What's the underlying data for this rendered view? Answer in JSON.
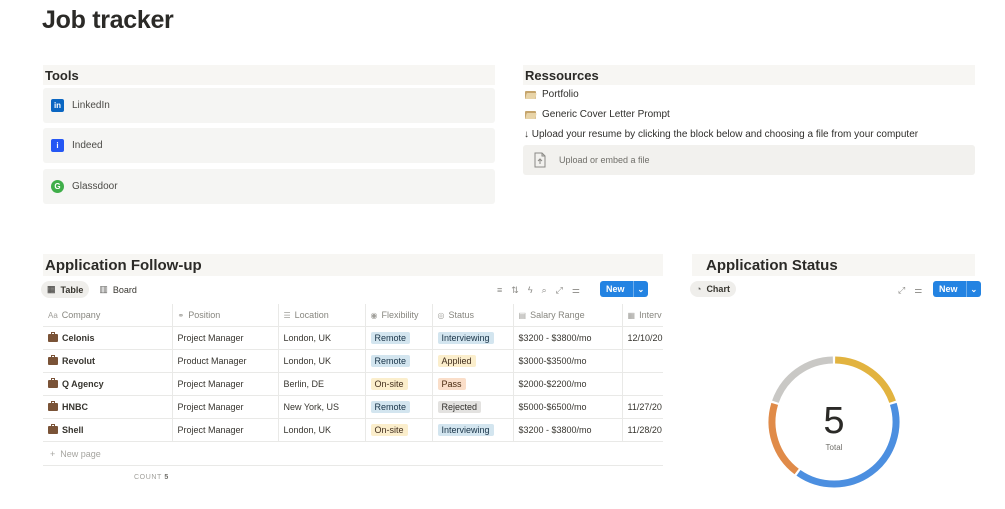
{
  "page": {
    "title": "Job tracker"
  },
  "tools": {
    "heading": "Tools",
    "items": [
      {
        "label": "LinkedIn",
        "icon": "linkedin-icon",
        "color": "#0a66c2",
        "glyph": "in"
      },
      {
        "label": "Indeed",
        "icon": "indeed-icon",
        "color": "#2557f4",
        "glyph": "i"
      },
      {
        "label": "Glassdoor",
        "icon": "glassdoor-icon",
        "color": "#3fae49",
        "glyph": "G"
      }
    ]
  },
  "resources": {
    "heading": "Ressources",
    "links": [
      {
        "label": "Portfolio",
        "icon": "folder-icon"
      },
      {
        "label": "Generic Cover Letter Prompt",
        "icon": "folder-icon"
      }
    ],
    "note": "↓ Upload your resume by clicking the block below and choosing a file from your computer",
    "upload_label": "Upload or embed a file"
  },
  "followup": {
    "heading": "Application Follow-up",
    "tabs": [
      {
        "label": "Table",
        "icon": "table-icon",
        "active": true
      },
      {
        "label": "Board",
        "icon": "board-icon",
        "active": false
      }
    ],
    "new_label": "New",
    "columns": [
      {
        "label": "Company",
        "icon": "title-icon",
        "glyph": "Aa"
      },
      {
        "label": "Position",
        "icon": "link-icon",
        "glyph": "⚭"
      },
      {
        "label": "Location",
        "icon": "text-icon",
        "glyph": "☰"
      },
      {
        "label": "Flexibility",
        "icon": "select-icon",
        "glyph": "◉"
      },
      {
        "label": "Status",
        "icon": "status-icon",
        "glyph": "◎"
      },
      {
        "label": "Salary Range",
        "icon": "money-icon",
        "glyph": "▤"
      },
      {
        "label": "Interv",
        "icon": "date-icon",
        "glyph": "▦"
      }
    ],
    "rows": [
      {
        "company": "Celonis",
        "position": "Project Manager",
        "location": "London, UK",
        "flexibility": "Remote",
        "flex_color": "blue",
        "status": "Interviewing",
        "status_color": "blue",
        "salary": "$3200 - $3800/mo",
        "interview": "12/10/20"
      },
      {
        "company": "Revolut",
        "position": "Product Manager",
        "location": "London, UK",
        "flexibility": "Remote",
        "flex_color": "blue",
        "status": "Applied",
        "status_color": "yellow",
        "salary": "$3000-$3500/mo",
        "interview": ""
      },
      {
        "company": "Q Agency",
        "position": "Project Manager",
        "location": "Berlin, DE",
        "flexibility": "On-site",
        "flex_color": "yellow",
        "status": "Pass",
        "status_color": "orange",
        "salary": "$2000-$2200/mo",
        "interview": ""
      },
      {
        "company": "HNBC",
        "position": "Project Manager",
        "location": "New York, US",
        "flexibility": "Remote",
        "flex_color": "blue",
        "status": "Rejected",
        "status_color": "gray",
        "salary": "$5000-$6500/mo",
        "interview": "11/27/20"
      },
      {
        "company": "Shell",
        "position": "Project Manager",
        "location": "London, UK",
        "flexibility": "On-site",
        "flex_color": "yellow",
        "status": "Interviewing",
        "status_color": "blue",
        "salary": "$3200 - $3800/mo",
        "interview": "11/28/20"
      }
    ],
    "new_page_label": "New page",
    "count_label": "COUNT",
    "count_value": "5"
  },
  "status_chart": {
    "heading": "Application Status",
    "tab_label": "Chart",
    "new_label": "New",
    "total_value": "5",
    "total_label": "Total",
    "chart_data": {
      "type": "pie",
      "slices": [
        {
          "value": 1,
          "color": "#e2b33f"
        },
        {
          "value": 2,
          "color": "#4c8fe0"
        },
        {
          "value": 1,
          "color": "#e08b49"
        },
        {
          "value": 1,
          "color": "#c9c8c5"
        }
      ]
    }
  }
}
